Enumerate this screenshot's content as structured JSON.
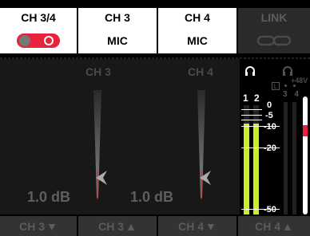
{
  "tabs": [
    {
      "label": "CH 3/4"
    },
    {
      "label": "CH 3"
    },
    {
      "label": "CH 4"
    },
    {
      "label": "LINK"
    }
  ],
  "row2": {
    "ch3_input": "MIC",
    "ch4_input": "MIC"
  },
  "faders": {
    "ch3": {
      "label": "CH 3",
      "value": "1.0 dB",
      "level": 0.87
    },
    "ch4": {
      "label": "CH 4",
      "value": "1.0 dB",
      "level": 0.87
    }
  },
  "meter": {
    "ch_numbers": "1 2",
    "phantom": "+48V",
    "phantom_ch": "3 4",
    "badge": "L",
    "scale": [
      "0",
      "-5",
      "-10",
      "-20",
      "-50"
    ],
    "level_fraction": 0.83
  },
  "bottom": [
    {
      "label": "CH 3",
      "arrow": "▼"
    },
    {
      "label": "CH 3",
      "arrow": "▲"
    },
    {
      "label": "CH 4",
      "arrow": "▼"
    },
    {
      "label": "CH 4",
      "arrow": "▲"
    }
  ],
  "colors": {
    "toggle_on": "#e8223a",
    "meter_fill": "#c8f02a",
    "meter_peak": "#e8223a"
  }
}
